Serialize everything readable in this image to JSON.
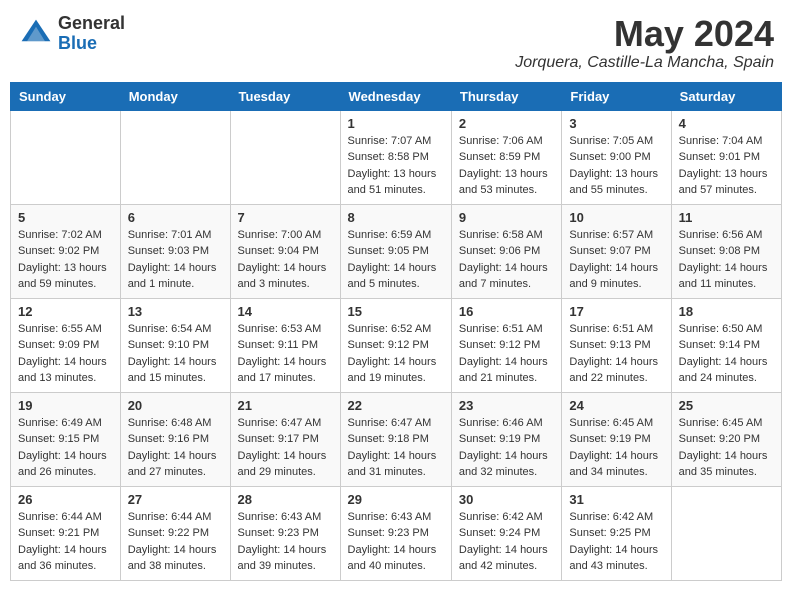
{
  "header": {
    "logo_general": "General",
    "logo_blue": "Blue",
    "month": "May 2024",
    "location": "Jorquera, Castille-La Mancha, Spain"
  },
  "weekdays": [
    "Sunday",
    "Monday",
    "Tuesday",
    "Wednesday",
    "Thursday",
    "Friday",
    "Saturday"
  ],
  "weeks": [
    [
      {
        "day": "",
        "sunrise": "",
        "sunset": "",
        "daylight": ""
      },
      {
        "day": "",
        "sunrise": "",
        "sunset": "",
        "daylight": ""
      },
      {
        "day": "",
        "sunrise": "",
        "sunset": "",
        "daylight": ""
      },
      {
        "day": "1",
        "sunrise": "Sunrise: 7:07 AM",
        "sunset": "Sunset: 8:58 PM",
        "daylight": "Daylight: 13 hours and 51 minutes."
      },
      {
        "day": "2",
        "sunrise": "Sunrise: 7:06 AM",
        "sunset": "Sunset: 8:59 PM",
        "daylight": "Daylight: 13 hours and 53 minutes."
      },
      {
        "day": "3",
        "sunrise": "Sunrise: 7:05 AM",
        "sunset": "Sunset: 9:00 PM",
        "daylight": "Daylight: 13 hours and 55 minutes."
      },
      {
        "day": "4",
        "sunrise": "Sunrise: 7:04 AM",
        "sunset": "Sunset: 9:01 PM",
        "daylight": "Daylight: 13 hours and 57 minutes."
      }
    ],
    [
      {
        "day": "5",
        "sunrise": "Sunrise: 7:02 AM",
        "sunset": "Sunset: 9:02 PM",
        "daylight": "Daylight: 13 hours and 59 minutes."
      },
      {
        "day": "6",
        "sunrise": "Sunrise: 7:01 AM",
        "sunset": "Sunset: 9:03 PM",
        "daylight": "Daylight: 14 hours and 1 minute."
      },
      {
        "day": "7",
        "sunrise": "Sunrise: 7:00 AM",
        "sunset": "Sunset: 9:04 PM",
        "daylight": "Daylight: 14 hours and 3 minutes."
      },
      {
        "day": "8",
        "sunrise": "Sunrise: 6:59 AM",
        "sunset": "Sunset: 9:05 PM",
        "daylight": "Daylight: 14 hours and 5 minutes."
      },
      {
        "day": "9",
        "sunrise": "Sunrise: 6:58 AM",
        "sunset": "Sunset: 9:06 PM",
        "daylight": "Daylight: 14 hours and 7 minutes."
      },
      {
        "day": "10",
        "sunrise": "Sunrise: 6:57 AM",
        "sunset": "Sunset: 9:07 PM",
        "daylight": "Daylight: 14 hours and 9 minutes."
      },
      {
        "day": "11",
        "sunrise": "Sunrise: 6:56 AM",
        "sunset": "Sunset: 9:08 PM",
        "daylight": "Daylight: 14 hours and 11 minutes."
      }
    ],
    [
      {
        "day": "12",
        "sunrise": "Sunrise: 6:55 AM",
        "sunset": "Sunset: 9:09 PM",
        "daylight": "Daylight: 14 hours and 13 minutes."
      },
      {
        "day": "13",
        "sunrise": "Sunrise: 6:54 AM",
        "sunset": "Sunset: 9:10 PM",
        "daylight": "Daylight: 14 hours and 15 minutes."
      },
      {
        "day": "14",
        "sunrise": "Sunrise: 6:53 AM",
        "sunset": "Sunset: 9:11 PM",
        "daylight": "Daylight: 14 hours and 17 minutes."
      },
      {
        "day": "15",
        "sunrise": "Sunrise: 6:52 AM",
        "sunset": "Sunset: 9:12 PM",
        "daylight": "Daylight: 14 hours and 19 minutes."
      },
      {
        "day": "16",
        "sunrise": "Sunrise: 6:51 AM",
        "sunset": "Sunset: 9:12 PM",
        "daylight": "Daylight: 14 hours and 21 minutes."
      },
      {
        "day": "17",
        "sunrise": "Sunrise: 6:51 AM",
        "sunset": "Sunset: 9:13 PM",
        "daylight": "Daylight: 14 hours and 22 minutes."
      },
      {
        "day": "18",
        "sunrise": "Sunrise: 6:50 AM",
        "sunset": "Sunset: 9:14 PM",
        "daylight": "Daylight: 14 hours and 24 minutes."
      }
    ],
    [
      {
        "day": "19",
        "sunrise": "Sunrise: 6:49 AM",
        "sunset": "Sunset: 9:15 PM",
        "daylight": "Daylight: 14 hours and 26 minutes."
      },
      {
        "day": "20",
        "sunrise": "Sunrise: 6:48 AM",
        "sunset": "Sunset: 9:16 PM",
        "daylight": "Daylight: 14 hours and 27 minutes."
      },
      {
        "day": "21",
        "sunrise": "Sunrise: 6:47 AM",
        "sunset": "Sunset: 9:17 PM",
        "daylight": "Daylight: 14 hours and 29 minutes."
      },
      {
        "day": "22",
        "sunrise": "Sunrise: 6:47 AM",
        "sunset": "Sunset: 9:18 PM",
        "daylight": "Daylight: 14 hours and 31 minutes."
      },
      {
        "day": "23",
        "sunrise": "Sunrise: 6:46 AM",
        "sunset": "Sunset: 9:19 PM",
        "daylight": "Daylight: 14 hours and 32 minutes."
      },
      {
        "day": "24",
        "sunrise": "Sunrise: 6:45 AM",
        "sunset": "Sunset: 9:19 PM",
        "daylight": "Daylight: 14 hours and 34 minutes."
      },
      {
        "day": "25",
        "sunrise": "Sunrise: 6:45 AM",
        "sunset": "Sunset: 9:20 PM",
        "daylight": "Daylight: 14 hours and 35 minutes."
      }
    ],
    [
      {
        "day": "26",
        "sunrise": "Sunrise: 6:44 AM",
        "sunset": "Sunset: 9:21 PM",
        "daylight": "Daylight: 14 hours and 36 minutes."
      },
      {
        "day": "27",
        "sunrise": "Sunrise: 6:44 AM",
        "sunset": "Sunset: 9:22 PM",
        "daylight": "Daylight: 14 hours and 38 minutes."
      },
      {
        "day": "28",
        "sunrise": "Sunrise: 6:43 AM",
        "sunset": "Sunset: 9:23 PM",
        "daylight": "Daylight: 14 hours and 39 minutes."
      },
      {
        "day": "29",
        "sunrise": "Sunrise: 6:43 AM",
        "sunset": "Sunset: 9:23 PM",
        "daylight": "Daylight: 14 hours and 40 minutes."
      },
      {
        "day": "30",
        "sunrise": "Sunrise: 6:42 AM",
        "sunset": "Sunset: 9:24 PM",
        "daylight": "Daylight: 14 hours and 42 minutes."
      },
      {
        "day": "31",
        "sunrise": "Sunrise: 6:42 AM",
        "sunset": "Sunset: 9:25 PM",
        "daylight": "Daylight: 14 hours and 43 minutes."
      },
      {
        "day": "",
        "sunrise": "",
        "sunset": "",
        "daylight": ""
      }
    ]
  ]
}
